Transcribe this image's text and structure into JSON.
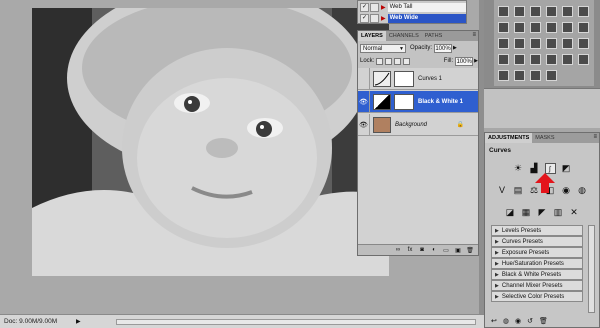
{
  "status_bar": {
    "doc_info": "Doc: 9.00M/9.00M",
    "arrow": "▶"
  },
  "preset_panel": {
    "items": [
      {
        "label": "Web Tall",
        "selected": false,
        "eye": "✓"
      },
      {
        "label": "Web Wide",
        "selected": true,
        "eye": "✓"
      }
    ]
  },
  "layers_panel": {
    "tabs": [
      "LAYERS",
      "CHANNELS",
      "PATHS"
    ],
    "menu_icon": "≡",
    "blend_mode": "Normal",
    "opacity_label": "Opacity:",
    "opacity_value": "100%",
    "lock_label": "Lock:",
    "fill_label": "Fill:",
    "fill_value": "100%",
    "layers": [
      {
        "name": "Curves 1",
        "selected": false,
        "eye": ""
      },
      {
        "name": "Black & White 1",
        "selected": true,
        "eye": "👁"
      },
      {
        "name": "Background",
        "selected": false,
        "eye": "👁",
        "locked_icon": "🔒"
      }
    ],
    "footer_icons": [
      "link-icon",
      "fx-icon",
      "mask-icon",
      "adjustment-icon",
      "folder-icon",
      "new-layer-icon",
      "trash-icon"
    ]
  },
  "adjustments_panel": {
    "tabs": [
      "ADJUSTMENTS",
      "MASKS"
    ],
    "menu_icon": "≡",
    "title": "Curves",
    "presets": [
      "Levels Presets",
      "Curves Presets",
      "Exposure Presets",
      "Hue/Saturation Presets",
      "Black & White Presets",
      "Channel Mixer Presets",
      "Selective Color Presets"
    ]
  },
  "colors": {
    "selection_blue": "#2f5fd0",
    "arrow_red": "#e3141b",
    "panel_gray": "#c6c6c6"
  }
}
